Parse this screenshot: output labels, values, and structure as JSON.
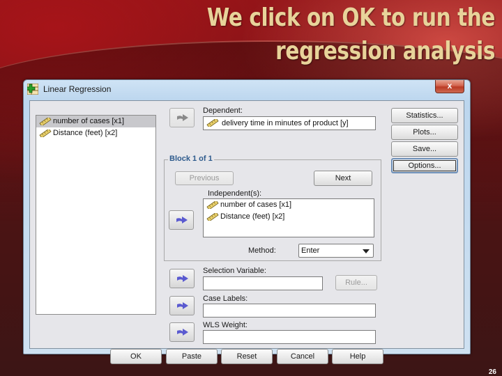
{
  "slide": {
    "title": "We click on OK to run the regression analysis",
    "page_number": "26"
  },
  "window": {
    "title": "Linear Regression",
    "close_label": "x"
  },
  "variables": [
    {
      "label": "number of cases [x1]",
      "selected": true
    },
    {
      "label": "Distance (feet) [x2]",
      "selected": false
    }
  ],
  "dependent": {
    "label": "Dependent:",
    "value": "delivery time in minutes of product [y]"
  },
  "block": {
    "title": "Block 1 of 1",
    "previous_label": "Previous",
    "next_label": "Next",
    "independents_label": "Independent(s):",
    "independents": [
      "number of cases [x1]",
      "Distance (feet) [x2]"
    ],
    "method_label": "Method:",
    "method_value": "Enter"
  },
  "selection_variable": {
    "label": "Selection Variable:",
    "value": "",
    "rule_label": "Rule..."
  },
  "case_labels": {
    "label": "Case Labels:",
    "value": ""
  },
  "wls_weight": {
    "label": "WLS Weight:",
    "value": ""
  },
  "side_buttons": {
    "statistics": "Statistics...",
    "plots": "Plots...",
    "save": "Save...",
    "options": "Options..."
  },
  "bottom_buttons": {
    "ok": "OK",
    "paste": "Paste",
    "reset": "Reset",
    "cancel": "Cancel",
    "help": "Help"
  },
  "colors": {
    "title_text": "#e8d39a",
    "group_title": "#2d5a8c",
    "arrow_enabled": "#5a5ad0",
    "arrow_disabled": "#8a8a8a"
  }
}
